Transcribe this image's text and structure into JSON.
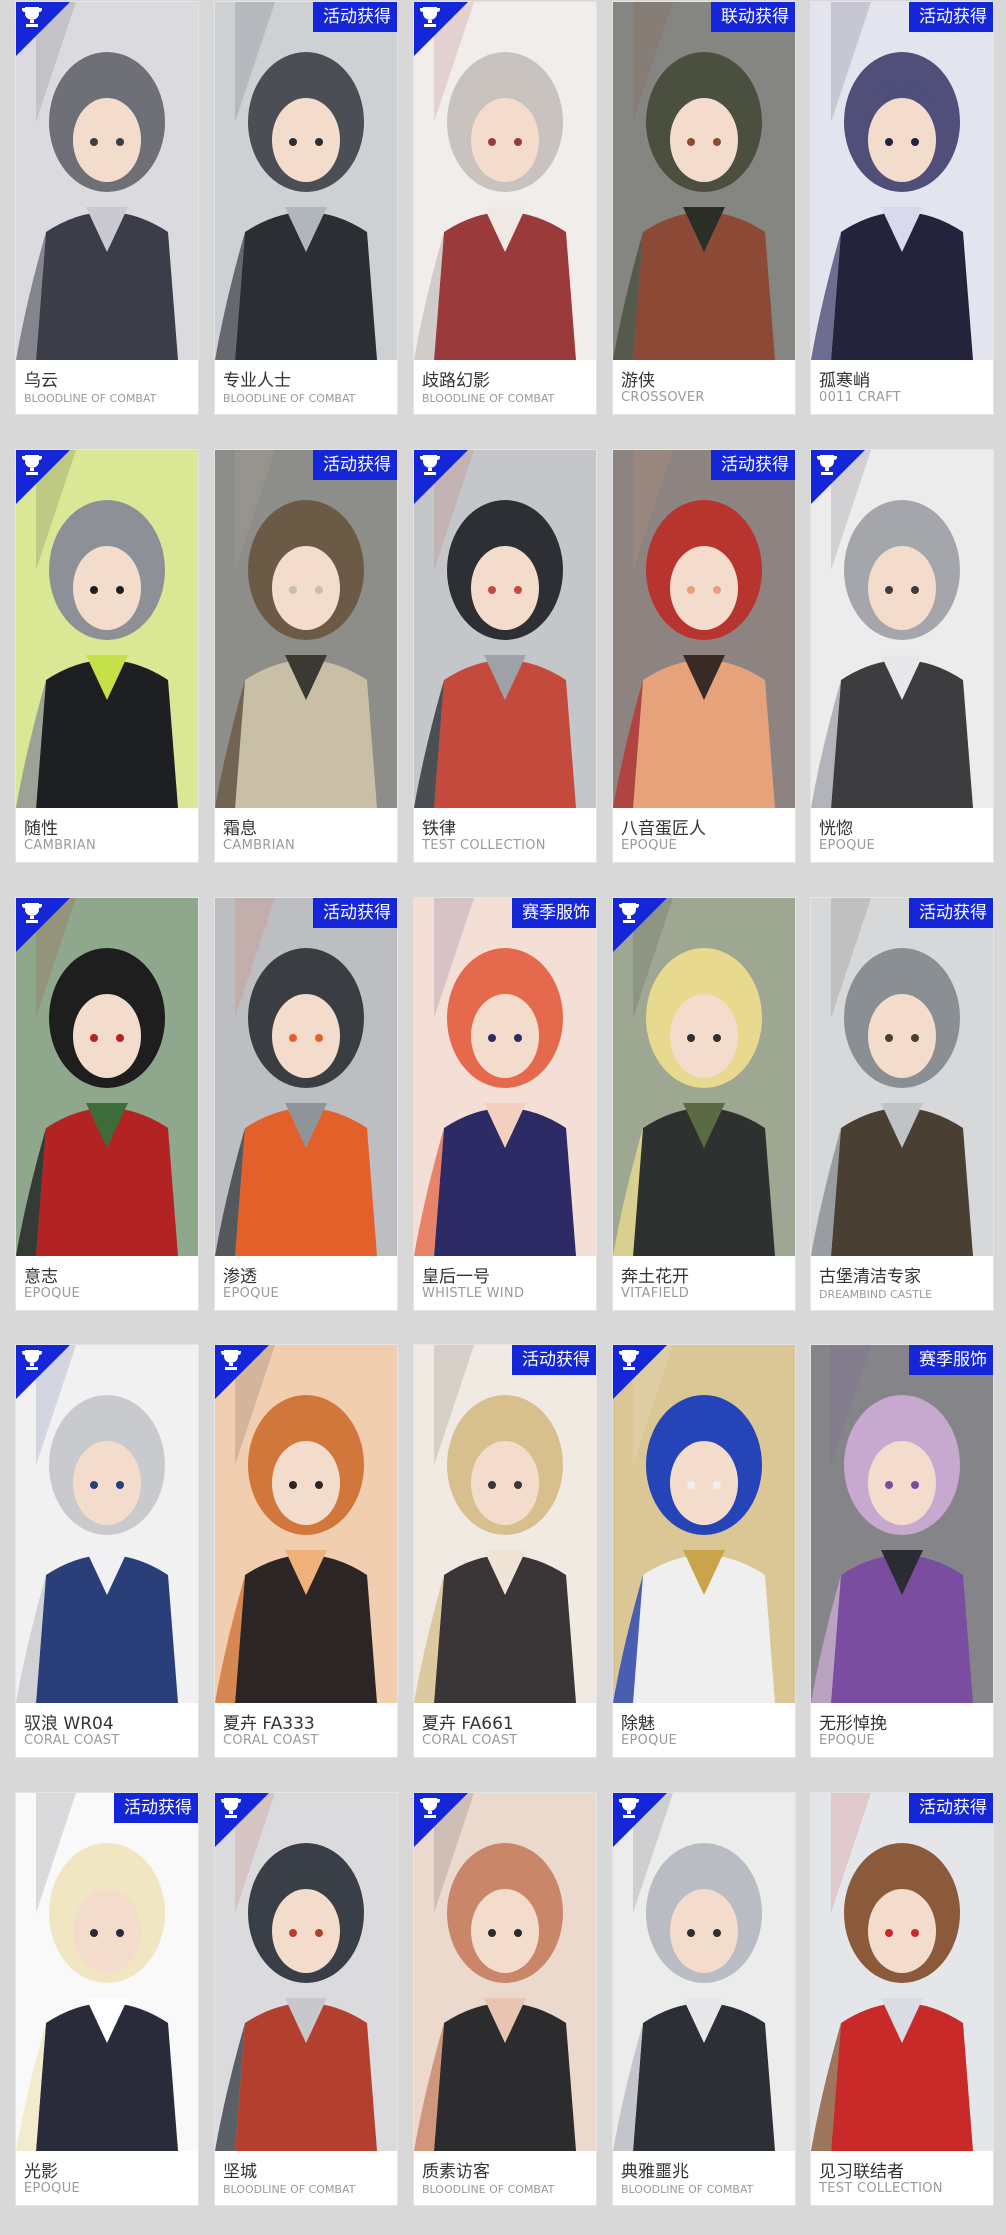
{
  "colors": {
    "badge": "#1526d8",
    "background": "#d8d8d8",
    "name_text": "#333333",
    "series_text": "#9a9a9a"
  },
  "corner_icon": "trophy-icon",
  "cards": [
    {
      "name": "乌云",
      "series": "BLOODLINE OF COMBAT",
      "badge": "",
      "corner": true,
      "palette": [
        "#6f6f78",
        "#3b3d49",
        "#c9c9cf"
      ]
    },
    {
      "name": "专业人士",
      "series": "BLOODLINE OF COMBAT",
      "badge": "活动获得",
      "corner": false,
      "palette": [
        "#4b4f55",
        "#2b2e33",
        "#b0b6bb"
      ]
    },
    {
      "name": "歧路幻影",
      "series": "BLOODLINE OF COMBAT",
      "badge": "",
      "corner": true,
      "palette": [
        "#c9c3bf",
        "#9b3a3a",
        "#efe9e4"
      ]
    },
    {
      "name": "游侠",
      "series": "CROSSOVER",
      "badge": "联动获得",
      "corner": false,
      "palette": [
        "#4a4f3f",
        "#8c4a36",
        "#2b2d27"
      ]
    },
    {
      "name": "孤寒峭",
      "series": "0011 CRAFT",
      "badge": "活动获得",
      "corner": false,
      "palette": [
        "#4f4f7a",
        "#23233b",
        "#d9d9ec"
      ]
    },
    {
      "name": "随性",
      "series": "CAMBRIAN",
      "badge": "",
      "corner": true,
      "palette": [
        "#8d9097",
        "#1e1f22",
        "#c6e04a"
      ]
    },
    {
      "name": "霜息",
      "series": "CAMBRIAN",
      "badge": "活动获得",
      "corner": false,
      "palette": [
        "#6b5a45",
        "#c8bfa6",
        "#3a3a33"
      ]
    },
    {
      "name": "铁律",
      "series": "TEST COLLECTION",
      "badge": "",
      "corner": true,
      "palette": [
        "#2d2f34",
        "#c44a3e",
        "#9ea2a8"
      ]
    },
    {
      "name": "八音蛋匠人",
      "series": "EPOQUE",
      "badge": "活动获得",
      "corner": false,
      "palette": [
        "#b8352f",
        "#e6a27a",
        "#3a2a26"
      ]
    },
    {
      "name": "恍惚",
      "series": "EPOQUE",
      "badge": "",
      "corner": true,
      "palette": [
        "#a4a6ab",
        "#3d3d40",
        "#e8e8ea"
      ]
    },
    {
      "name": "意志",
      "series": "EPOQUE",
      "badge": "",
      "corner": true,
      "palette": [
        "#1e1e1e",
        "#b32323",
        "#3e6b3a"
      ]
    },
    {
      "name": "渗透",
      "series": "EPOQUE",
      "badge": "活动获得",
      "corner": false,
      "palette": [
        "#3a3d42",
        "#e4602b",
        "#8f949a"
      ]
    },
    {
      "name": "皇后一号",
      "series": "WHISTLE WIND",
      "badge": "赛季服饰",
      "corner": false,
      "palette": [
        "#e56a4d",
        "#2c2b66",
        "#f4d0c0"
      ]
    },
    {
      "name": "奔土花开",
      "series": "VITAFIELD",
      "badge": "",
      "corner": true,
      "palette": [
        "#e7d98e",
        "#2f3130",
        "#5a6a43"
      ]
    },
    {
      "name": "古堡清洁专家",
      "series": "DREAMBIND CASTLE",
      "badge": "活动获得",
      "corner": false,
      "palette": [
        "#8a8f93",
        "#4a3f33",
        "#bfc3c6"
      ]
    },
    {
      "name": "驭浪 WR04",
      "series": "CORAL COAST",
      "badge": "",
      "corner": true,
      "palette": [
        "#c9cacd",
        "#2a3f79",
        "#f1f1f3"
      ]
    },
    {
      "name": "夏卉 FA333",
      "series": "CORAL COAST",
      "badge": "",
      "corner": true,
      "palette": [
        "#d1773b",
        "#2b2625",
        "#f0b07a"
      ]
    },
    {
      "name": "夏卉 FA661",
      "series": "CORAL COAST",
      "badge": "活动获得",
      "corner": false,
      "palette": [
        "#d8c08e",
        "#3a3536",
        "#f0e4d6"
      ]
    },
    {
      "name": "除魅",
      "series": "EPOQUE",
      "badge": "",
      "corner": true,
      "palette": [
        "#2444b8",
        "#efefef",
        "#c9a44a"
      ]
    },
    {
      "name": "无形悼挽",
      "series": "EPOQUE",
      "badge": "赛季服饰",
      "corner": false,
      "palette": [
        "#c7a9cf",
        "#7b4da0",
        "#2b2b33"
      ]
    },
    {
      "name": "光影",
      "series": "EPOQUE",
      "badge": "活动获得",
      "corner": false,
      "palette": [
        "#f0e7c2",
        "#2a2b3a",
        "#ffffff"
      ]
    },
    {
      "name": "坚城",
      "series": "BLOODLINE OF COMBAT",
      "badge": "",
      "corner": true,
      "palette": [
        "#3a3f47",
        "#b3402e",
        "#c8c8cc"
      ]
    },
    {
      "name": "质素访客",
      "series": "BLOODLINE OF COMBAT",
      "badge": "",
      "corner": true,
      "palette": [
        "#c98669",
        "#2c2b2e",
        "#e8c5b0"
      ]
    },
    {
      "name": "典雅噩兆",
      "series": "BLOODLINE OF COMBAT",
      "badge": "",
      "corner": true,
      "palette": [
        "#b9bcc2",
        "#2c2f36",
        "#e8e8ea"
      ]
    },
    {
      "name": "见习联结者",
      "series": "TEST COLLECTION",
      "badge": "活动获得",
      "corner": false,
      "palette": [
        "#8a5a3a",
        "#c82a2a",
        "#d9dde3"
      ]
    }
  ]
}
